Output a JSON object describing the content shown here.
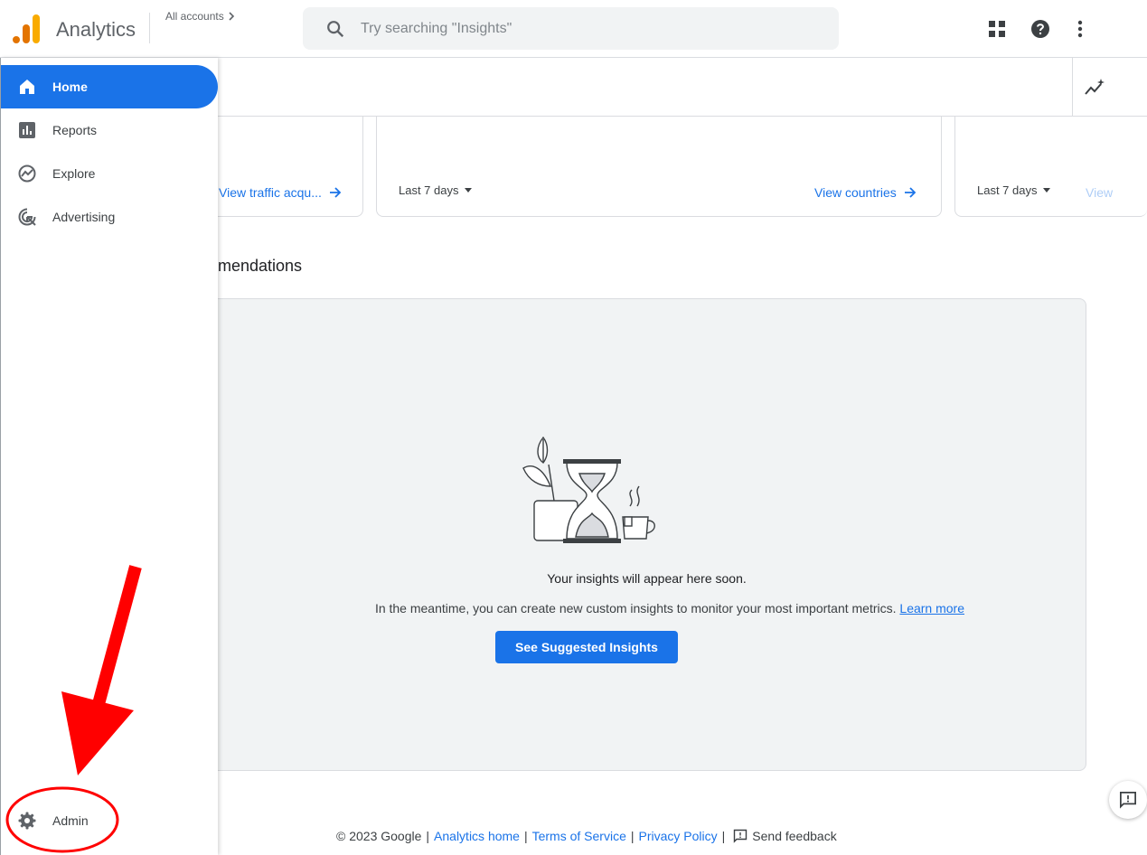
{
  "header": {
    "app_name": "Analytics",
    "accounts_label": "All accounts",
    "search_placeholder": "Try searching \"Insights\""
  },
  "sidebar": {
    "items": [
      {
        "label": "Home",
        "icon": "home-icon",
        "active": true
      },
      {
        "label": "Reports",
        "icon": "bar-chart-icon"
      },
      {
        "label": "Explore",
        "icon": "explore-icon"
      },
      {
        "label": "Advertising",
        "icon": "advertising-icon"
      }
    ],
    "admin_label": "Admin"
  },
  "cards": [
    {
      "link": "View traffic acqu..."
    },
    {
      "period": "Last 7 days",
      "link": "View countries"
    },
    {
      "period": "Last 7 days",
      "link": "View"
    }
  ],
  "insights": {
    "section_title": "mendations",
    "message": "Your insights will appear here soon.",
    "description": "In the meantime, you can create new custom insights to monitor your most important metrics.",
    "learn_more": "Learn more",
    "button": "See Suggested Insights"
  },
  "footer": {
    "copyright": "© 2023 Google",
    "sep": "|",
    "links": [
      "Analytics home",
      "Terms of Service",
      "Privacy Policy"
    ],
    "feedback": "Send feedback"
  },
  "colors": {
    "accent": "#1a73e8",
    "annotation": "#ff0000"
  }
}
